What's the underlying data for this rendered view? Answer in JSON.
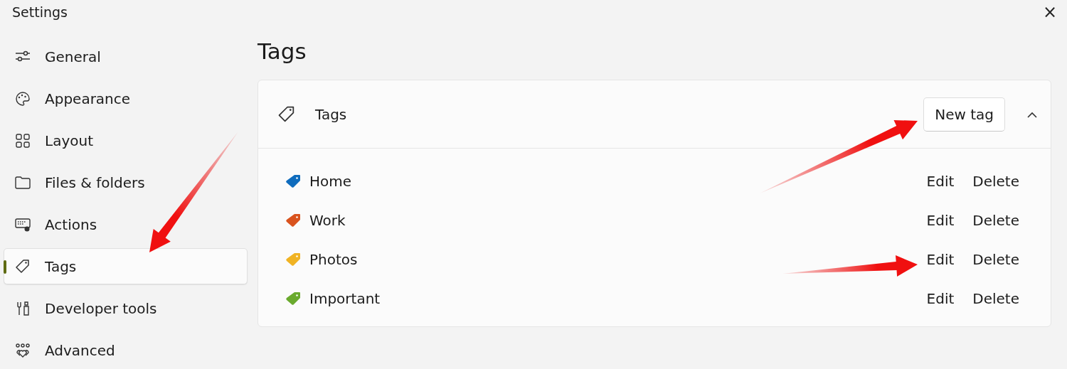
{
  "window": {
    "title": "Settings",
    "close": "×"
  },
  "sidebar": {
    "items": [
      {
        "label": "General",
        "selected": false
      },
      {
        "label": "Appearance",
        "selected": false
      },
      {
        "label": "Layout",
        "selected": false
      },
      {
        "label": "Files & folders",
        "selected": false
      },
      {
        "label": "Actions",
        "selected": false
      },
      {
        "label": "Tags",
        "selected": true
      },
      {
        "label": "Developer tools",
        "selected": false
      },
      {
        "label": "Advanced",
        "selected": false
      }
    ]
  },
  "page": {
    "title": "Tags"
  },
  "tags_card": {
    "title": "Tags",
    "new_button": "New tag",
    "expanded": true,
    "tags": [
      {
        "name": "Home",
        "color": "#0f6cbd",
        "edit": "Edit",
        "delete": "Delete"
      },
      {
        "name": "Work",
        "color": "#d9531e",
        "edit": "Edit",
        "delete": "Delete"
      },
      {
        "name": "Photos",
        "color": "#f0b323",
        "edit": "Edit",
        "delete": "Delete"
      },
      {
        "name": "Important",
        "color": "#6aaa2e",
        "edit": "Edit",
        "delete": "Delete"
      }
    ]
  }
}
